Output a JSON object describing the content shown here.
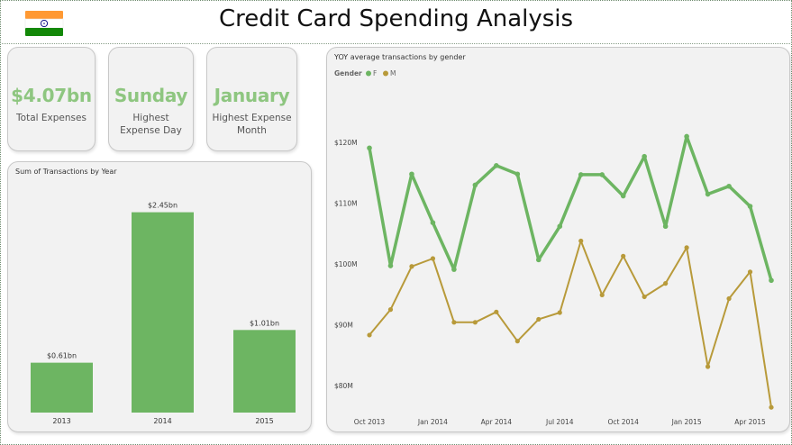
{
  "header": {
    "title": "Credit Card Spending Analysis",
    "flag_icon": "india-flag-icon",
    "flag_colors": {
      "saffron": "#ff9933",
      "white": "#ffffff",
      "green": "#138808",
      "chakra": "#000080"
    }
  },
  "kpis": [
    {
      "value": "$4.07bn",
      "label": "Total Expenses"
    },
    {
      "value": "Sunday",
      "label": "Highest Expense Day"
    },
    {
      "value": "January",
      "label": "Highest Expense Month"
    }
  ],
  "colors": {
    "accent": "#8ec680",
    "bar": "#6db562",
    "female": "#6db562",
    "male": "#b89a3a",
    "card_bg": "#f2f2f2"
  },
  "chart_data": [
    {
      "type": "bar",
      "title": "Sum of Transactions by Year",
      "categories": [
        "2013",
        "2014",
        "2015"
      ],
      "values": [
        0.61,
        2.45,
        1.01
      ],
      "data_labels": [
        "$0.61bn",
        "$2.45bn",
        "$1.01bn"
      ],
      "unit": "bn",
      "ylim": [
        0,
        2.6
      ],
      "grid": false
    },
    {
      "type": "line",
      "title": "YOY average transactions by gender",
      "legend_title": "Gender",
      "legend_position": "top-left",
      "x": [
        "2013-10",
        "2013-11",
        "2013-12",
        "2014-01",
        "2014-02",
        "2014-03",
        "2014-04",
        "2014-05",
        "2014-06",
        "2014-07",
        "2014-08",
        "2014-09",
        "2014-10",
        "2014-11",
        "2014-12",
        "2015-01",
        "2015-02",
        "2015-03",
        "2015-04",
        "2015-05"
      ],
      "x_tick_labels": [
        "Oct 2013",
        "Jan 2014",
        "Apr 2014",
        "Jul 2014",
        "Oct 2014",
        "Jan 2015",
        "Apr 2015"
      ],
      "x_tick_months": [
        "2013-10",
        "2014-01",
        "2014-04",
        "2014-07",
        "2014-10",
        "2015-01",
        "2015-04"
      ],
      "y_tick_labels": [
        "$80M",
        "$90M",
        "$100M",
        "$110M",
        "$120M"
      ],
      "y_ticks": [
        80,
        90,
        100,
        110,
        120
      ],
      "ylim": [
        74.5,
        127
      ],
      "y_unit": "M",
      "grid": false,
      "series": [
        {
          "name": "F",
          "values": [
            119.1,
            99.7,
            114.8,
            106.8,
            99.1,
            113.0,
            116.2,
            114.8,
            100.7,
            106.2,
            114.7,
            114.7,
            111.2,
            117.7,
            106.2,
            121.0,
            111.5,
            112.8,
            109.5,
            97.3
          ]
        },
        {
          "name": "M",
          "values": [
            88.3,
            92.5,
            99.6,
            100.9,
            90.4,
            90.4,
            92.1,
            87.3,
            90.9,
            92.0,
            103.8,
            94.9,
            101.3,
            94.6,
            96.8,
            102.7,
            83.1,
            94.3,
            98.7,
            76.4
          ]
        }
      ]
    }
  ]
}
